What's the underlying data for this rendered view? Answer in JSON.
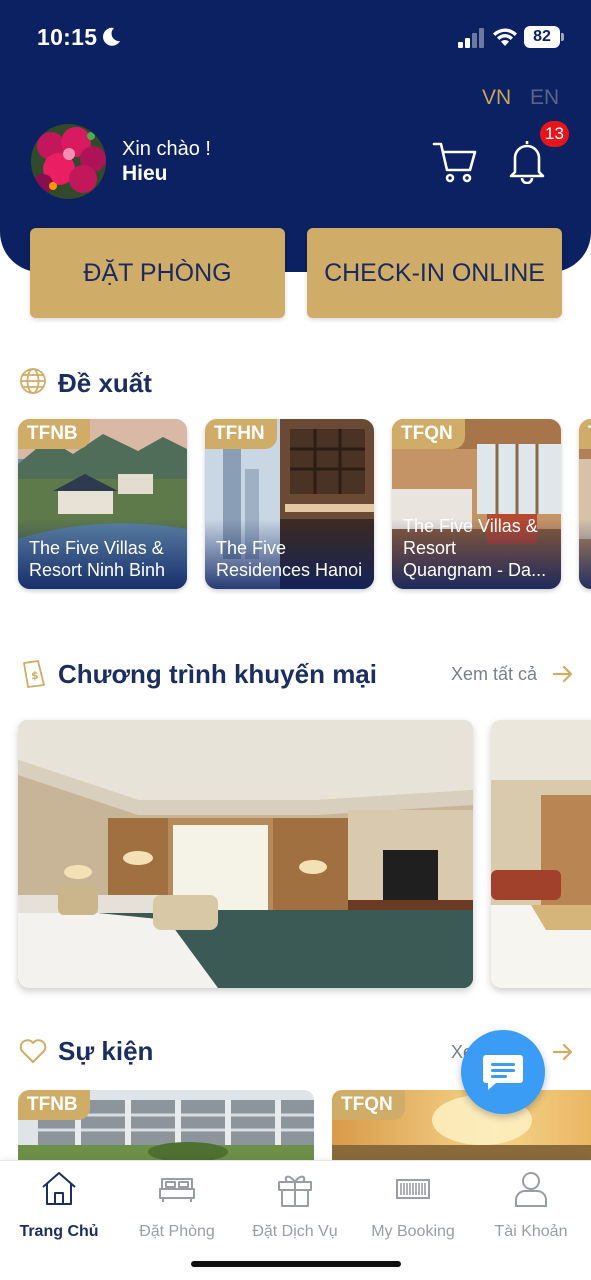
{
  "status_bar": {
    "time": "10:15",
    "battery": "82"
  },
  "header": {
    "lang_vn": "VN",
    "lang_en": "EN",
    "greeting": "Xin chào !",
    "user_name": "Hieu",
    "notification_count": "13"
  },
  "actions": {
    "book_room": "ĐẶT PHÒNG",
    "check_in": "CHECK-IN ONLINE"
  },
  "recommended": {
    "title": "Đề xuất",
    "items": [
      {
        "tag": "TFNB",
        "name": "The Five Villas &\nResort Ninh Binh"
      },
      {
        "tag": "TFHN",
        "name": "The Five\nResidences Hanoi"
      },
      {
        "tag": "TFQN",
        "name": "The Five Villas &\nResort\nQuangnam - Da..."
      },
      {
        "tag": "T",
        "name": ""
      }
    ]
  },
  "promotions": {
    "title": "Chương trình khuyến mại",
    "see_all": "Xem tất cả"
  },
  "events": {
    "title": "Sự kiện",
    "see_all": "Xem tất cả",
    "items": [
      {
        "tag": "TFNB"
      },
      {
        "tag": "TFQN"
      }
    ]
  },
  "bottom_nav": [
    {
      "label": "Trang Chủ",
      "icon": "home-icon",
      "active": true
    },
    {
      "label": "Đặt Phòng",
      "icon": "bed-icon",
      "active": false
    },
    {
      "label": "Đặt Dịch Vụ",
      "icon": "gift-icon",
      "active": false
    },
    {
      "label": "My Booking",
      "icon": "barcode-icon",
      "active": false
    },
    {
      "label": "Tài Khoản",
      "icon": "user-icon",
      "active": false
    }
  ],
  "colors": {
    "navy": "#0c2161",
    "gold": "#cfac67",
    "badge": "#e8141c",
    "fab": "#3b9cf5"
  }
}
